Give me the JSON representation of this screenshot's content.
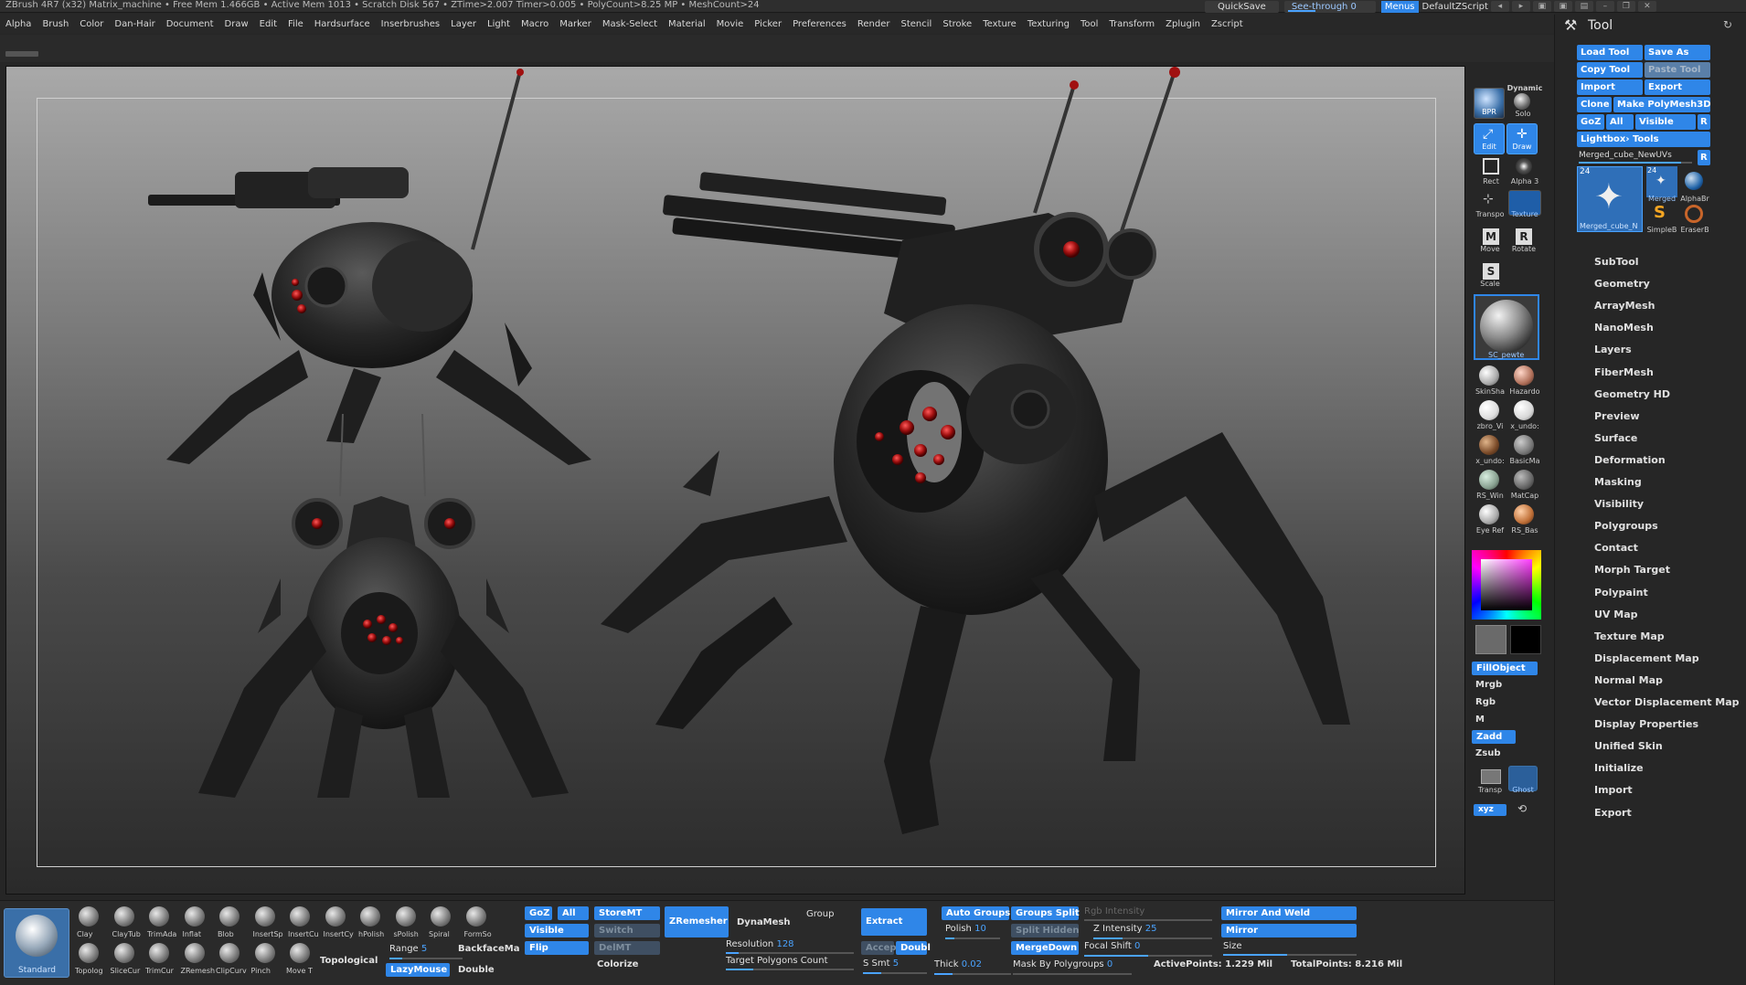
{
  "titlebar": {
    "info": "ZBrush 4R7 (x32)   Matrix_machine   • Free Mem 1.466GB • Active Mem 1013 • Scratch Disk 567 •  ZTime>2.007 Timer>0.005 • PolyCount>8.25 MP  • MeshCount>24",
    "quicksave": "QuickSave",
    "seethrough": "See-through  0",
    "menus": "Menus",
    "script": "DefaultZScript"
  },
  "menubar": [
    "Alpha",
    "Brush",
    "Color",
    "Dan-Hair",
    "Document",
    "Draw",
    "Edit",
    "File",
    "Hardsurface",
    "Inserbrushes",
    "Layer",
    "Light",
    "Macro",
    "Marker",
    "Mask-Select",
    "Material",
    "Movie",
    "Picker",
    "Preferences",
    "Render",
    "Stencil",
    "Stroke",
    "Texture",
    "Texturing",
    "Tool",
    "Transform",
    "Zplugin",
    "Zscript"
  ],
  "shelf": {
    "bpr": "BPR",
    "dynamic": "Dynamic",
    "solo": "Solo",
    "edit": "Edit",
    "draw": "Draw",
    "rect": "Rect",
    "alpha": "Alpha 3",
    "transp": "Transpo",
    "texture": "Texture",
    "move": "Move",
    "rotate": "Rotate",
    "scale": "Scale",
    "material": "SC_pewter",
    "mats": [
      "SkinSha",
      "Hazardo",
      "zbro_Vi",
      "x_undo:",
      "x_undo:",
      "BasicMa",
      "RS_Win",
      "MatCap",
      "Eye Ref",
      "RS_Bas"
    ],
    "fillobject": "FillObject",
    "mrgb": "Mrgb",
    "rgb": "Rgb",
    "m": "M",
    "zadd": "Zadd",
    "zsub": "Zsub",
    "transp2": "Transp",
    "ghost": "Ghost",
    "xyz": "xyz"
  },
  "tool": {
    "title": "Tool",
    "load": "Load Tool",
    "saveas": "Save As",
    "copy": "Copy Tool",
    "paste": "Paste Tool",
    "import": "Import",
    "export": "Export",
    "clone": "Clone",
    "make": "Make PolyMesh3D",
    "goz": "GoZ",
    "all": "All",
    "visible": "Visible",
    "r": "R",
    "lightbox": "Lightbox› Tools",
    "current": "Merged_cube_NewUVs",
    "r2": "R",
    "thumb_count": "24",
    "thumb_count2": "24",
    "thumb_main": "Merged_cube_N",
    "thumbs": [
      "Merged",
      "AlphaBr",
      "SimpleB",
      "EraserB"
    ],
    "menu": [
      "SubTool",
      "Geometry",
      "ArrayMesh",
      "NanoMesh",
      "Layers",
      "FiberMesh",
      "Geometry HD",
      "Preview",
      "Surface",
      "Deformation",
      "Masking",
      "Visibility",
      "Polygroups",
      "Contact",
      "Morph Target",
      "Polypaint",
      "UV Map",
      "Texture Map",
      "Displacement Map",
      "Normal Map",
      "Vector Displacement Map",
      "Display Properties",
      "Unified Skin",
      "Initialize",
      "Import",
      "Export"
    ]
  },
  "bottom": {
    "standard": "Standard",
    "brushes_row1": [
      "Clay",
      "ClayTub",
      "TrimAda",
      "Inflat",
      "Blob",
      "InsertSp",
      "InsertCu",
      "InsertCy",
      "hPolish",
      "sPolish",
      "Spiral",
      "FormSo"
    ],
    "brushes_row2": [
      "Topolog",
      "SliceCur",
      "TrimCur",
      "ZRemesh",
      "ClipCurv",
      "Pinch",
      "Move T"
    ],
    "topological": "Topological",
    "range_label": "Range",
    "range_value": "5",
    "backface": "BackfaceMa",
    "lazymouse": "LazyMouse",
    "double": "Double",
    "goz": "GoZ",
    "all": "All",
    "visible": "Visible",
    "flip": "Flip",
    "storemt": "StoreMT",
    "switch": "Switch",
    "delmt": "DelMT",
    "colorize": "Colorize",
    "zremesher": "ZRemesher",
    "dynamesh": "DynaMesh",
    "group": "Group",
    "resolution_label": "Resolution",
    "resolution_value": "128",
    "target": "Target Polygons Count",
    "extract": "Extract",
    "accept": "Accep",
    "double2": "Doubl",
    "ssmt_label": "S Smt",
    "ssmt_value": "5",
    "autogroup": "Auto Groups",
    "groupssplit": "Groups Split",
    "polish_label": "Polish",
    "polish_value": "10",
    "splithidden": "Split Hidden",
    "mergedown": "MergeDown",
    "thick_label": "Thick",
    "thick_value": "0.02",
    "rgbint": "Rgb Intensity",
    "zint_label": "Z Intensity",
    "zint_value": "25",
    "focal_label": "Focal Shift",
    "focal_value": "0",
    "mask_label": "Mask By Polygroups",
    "mask_value": "0",
    "mirrorweld": "Mirror And Weld",
    "mirror": "Mirror",
    "size": "Size",
    "active_label": "ActivePoints:",
    "active_value": "1.229",
    "mil": "Mil",
    "total_label": "TotalPoints:",
    "total_value": "8.216",
    "mil2": "Mil"
  },
  "colors": {
    "accent": "#2f86e8",
    "panel": "#262626",
    "canvas_top": "#a9a9a9",
    "canvas_bottom": "#2a2a2a",
    "eye_red": "#b01818"
  }
}
